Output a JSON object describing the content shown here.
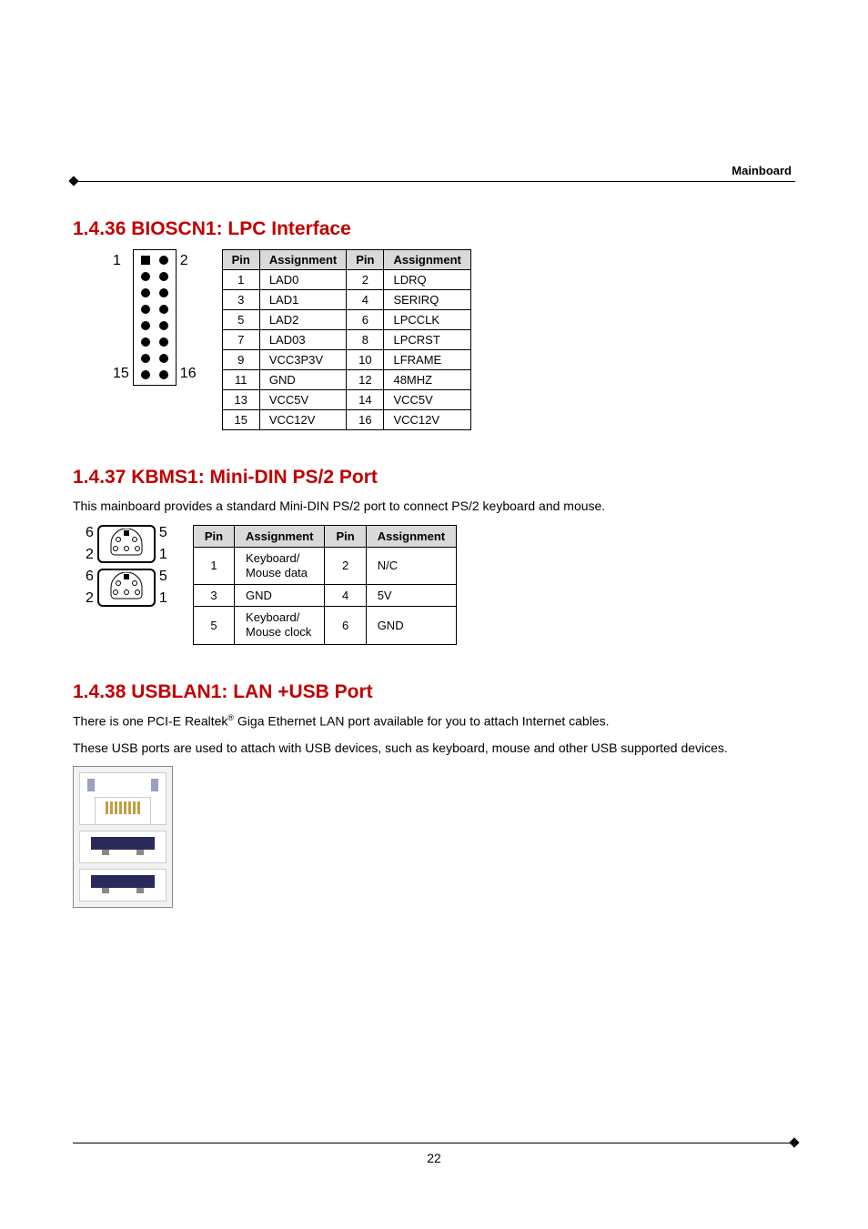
{
  "header": {
    "label": "Mainboard"
  },
  "s1": {
    "title": "1.4.36 BIOSCN1: LPC Interface",
    "diagram": {
      "tl": "1",
      "tr": "2",
      "bl": "15",
      "br": "16"
    },
    "table": {
      "head": [
        "Pin",
        "Assignment",
        "Pin",
        "Assignment"
      ],
      "rows": [
        [
          "1",
          "LAD0",
          "2",
          "LDRQ"
        ],
        [
          "3",
          "LAD1",
          "4",
          "SERIRQ"
        ],
        [
          "5",
          "LAD2",
          "6",
          "LPCCLK"
        ],
        [
          "7",
          "LAD03",
          "8",
          "LPCRST"
        ],
        [
          "9",
          "VCC3P3V",
          "10",
          "LFRAME"
        ],
        [
          "11",
          "GND",
          "12",
          "48MHZ"
        ],
        [
          "13",
          "VCC5V",
          "14",
          "VCC5V"
        ],
        [
          "15",
          "VCC12V",
          "16",
          "VCC12V"
        ]
      ]
    }
  },
  "s2": {
    "title": "1.4.37 KBMS1: Mini-DIN PS/2 Port",
    "desc": "This mainboard provides a standard Mini-DIN PS/2 port to connect PS/2 keyboard and mouse.",
    "diagram": {
      "tl": "6",
      "tr": "5",
      "bl": "2",
      "br": "1"
    },
    "table": {
      "head": [
        "Pin",
        "Assignment",
        "Pin",
        "Assignment"
      ],
      "rows": [
        [
          "1",
          "Keyboard/\nMouse data",
          "2",
          "N/C"
        ],
        [
          "3",
          "GND",
          "4",
          "5V"
        ],
        [
          "5",
          "Keyboard/\nMouse clock",
          "6",
          "GND"
        ]
      ]
    }
  },
  "s3": {
    "title": "1.4.38 USBLAN1: LAN +USB Port",
    "desc1a": "There is one PCI-E Realtek",
    "desc1b": " Giga Ethernet LAN port available for you to attach Internet cables.",
    "desc2": "These USB ports are used to attach with USB devices, such as keyboard, mouse and other USB supported devices.",
    "reg": "®"
  },
  "footer": {
    "page": "22"
  }
}
